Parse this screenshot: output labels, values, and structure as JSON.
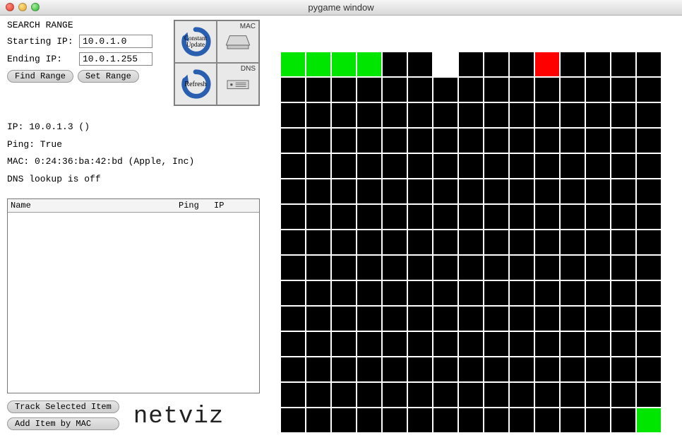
{
  "window": {
    "title": "pygame window"
  },
  "search": {
    "heading": "SEARCH RANGE",
    "start_label": "Starting IP:",
    "start_value": "10.0.1.0",
    "end_label": "Ending IP:",
    "end_value": "10.0.1.255",
    "find_label": "Find Range",
    "set_label": "Set Range"
  },
  "icon_buttons": {
    "constant_update": "Constant Update",
    "mac_label": "MAC",
    "refresh": "Refresh",
    "dns_label": "DNS"
  },
  "info": {
    "ip_line": "IP: 10.0.1.3 ()",
    "ping_line": "Ping: True",
    "mac_line": "MAC: 0:24:36:ba:42:bd (Apple, Inc)",
    "dns_line": "DNS lookup is off"
  },
  "list": {
    "col_name": "Name",
    "col_ping": "Ping",
    "col_ip": "IP"
  },
  "bottom": {
    "track_label": "Track Selected Item",
    "add_label": "Add Item by MAC",
    "logo": "netviz"
  },
  "grid": {
    "cols": 15,
    "rows": 15,
    "cells": [
      "green",
      "green",
      "green",
      "green",
      "black",
      "black",
      "white",
      "black",
      "black",
      "black",
      "red",
      "black",
      "black",
      "black",
      "black",
      "black",
      "black",
      "black",
      "black",
      "black",
      "black",
      "black",
      "black",
      "black",
      "black",
      "black",
      "black",
      "black",
      "black",
      "black",
      "black",
      "black",
      "black",
      "black",
      "black",
      "black",
      "black",
      "black",
      "black",
      "black",
      "black",
      "black",
      "black",
      "black",
      "black",
      "black",
      "black",
      "black",
      "black",
      "black",
      "black",
      "black",
      "black",
      "black",
      "black",
      "black",
      "black",
      "black",
      "black",
      "black",
      "black",
      "black",
      "black",
      "black",
      "black",
      "black",
      "black",
      "black",
      "black",
      "black",
      "black",
      "black",
      "black",
      "black",
      "black",
      "black",
      "black",
      "black",
      "black",
      "black",
      "black",
      "black",
      "black",
      "black",
      "black",
      "black",
      "black",
      "black",
      "black",
      "black",
      "black",
      "black",
      "black",
      "black",
      "black",
      "black",
      "black",
      "black",
      "black",
      "black",
      "black",
      "black",
      "black",
      "black",
      "black",
      "black",
      "black",
      "black",
      "black",
      "black",
      "black",
      "black",
      "black",
      "black",
      "black",
      "black",
      "black",
      "black",
      "black",
      "black",
      "black",
      "black",
      "black",
      "black",
      "black",
      "black",
      "black",
      "black",
      "black",
      "black",
      "black",
      "black",
      "black",
      "black",
      "black",
      "black",
      "black",
      "black",
      "black",
      "black",
      "black",
      "black",
      "black",
      "black",
      "black",
      "black",
      "black",
      "black",
      "black",
      "black",
      "black",
      "black",
      "black",
      "black",
      "black",
      "black",
      "black",
      "black",
      "black",
      "black",
      "black",
      "black",
      "black",
      "black",
      "black",
      "black",
      "black",
      "black",
      "black",
      "black",
      "black",
      "black",
      "black",
      "black",
      "black",
      "black",
      "black",
      "black",
      "black",
      "black",
      "black",
      "black",
      "black",
      "black",
      "black",
      "black",
      "black",
      "black",
      "black",
      "black",
      "black",
      "black",
      "black",
      "black",
      "black",
      "black",
      "black",
      "black",
      "black",
      "black",
      "black",
      "black",
      "black",
      "black",
      "black",
      "black",
      "black",
      "black",
      "black",
      "black",
      "black",
      "black",
      "black",
      "black",
      "black",
      "black",
      "black",
      "black",
      "black",
      "black",
      "black",
      "black",
      "black",
      "black",
      "green"
    ]
  }
}
